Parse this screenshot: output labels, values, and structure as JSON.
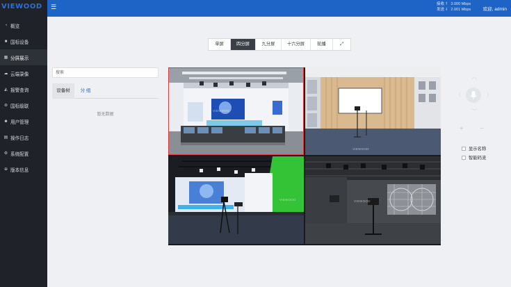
{
  "app": {
    "logo_text": "VIEWOOD"
  },
  "header": {
    "menu_icon": "menu-icon",
    "net": {
      "rx_label": "接收",
      "rx_value": "3.000 Mbps",
      "tx_label": "发送",
      "tx_value": "2.001 Mbps"
    },
    "welcome": "欢迎, admin"
  },
  "sidebar": {
    "items": [
      {
        "label": "概览",
        "icon": "gauge-icon",
        "glyph": "◔"
      },
      {
        "label": "国标设备",
        "icon": "camera-icon",
        "glyph": "■"
      },
      {
        "label": "分屏展示",
        "icon": "grid-icon",
        "glyph": "▦"
      },
      {
        "label": "云端录像",
        "icon": "cloud-icon",
        "glyph": "☁"
      },
      {
        "label": "报警查询",
        "icon": "bell-icon",
        "glyph": "◭"
      },
      {
        "label": "国标级联",
        "icon": "link-icon",
        "glyph": "⊛"
      },
      {
        "label": "用户管理",
        "icon": "user-icon",
        "glyph": "☻"
      },
      {
        "label": "操作日志",
        "icon": "file-icon",
        "glyph": "▤"
      },
      {
        "label": "系统配置",
        "icon": "gear-icon",
        "glyph": "⚙"
      },
      {
        "label": "版本信息",
        "icon": "info-icon",
        "glyph": "⊕"
      }
    ],
    "active_index": 2
  },
  "left_panel": {
    "search_placeholder": "搜索",
    "tabs": [
      "设备树",
      "分 组"
    ],
    "active_tab": 0,
    "empty_text": "暂无数据"
  },
  "split_toolbar": {
    "buttons": [
      "单屏",
      "四分屏",
      "九分屏",
      "十六分屏",
      "轮播"
    ],
    "active_index": 1,
    "fullscreen_icon": "fullscreen-icon"
  },
  "video_grid": {
    "watermark": "VIEWOOD",
    "selected_index": 0
  },
  "ptz": {
    "arrows": [
      "arrow-up-icon",
      "arrow-left-icon",
      "arrow-right-icon",
      "arrow-down-icon"
    ],
    "center_icon": "microphone-icon",
    "zoom_in": "+",
    "zoom_out": "−"
  },
  "options": {
    "show_name": "显示名称",
    "smart_stream": "智能码流"
  },
  "colors": {
    "header_blue": "#1e63c6",
    "sidebar_dark": "#1f2329",
    "toolbar_active": "#3a3f47",
    "selected_border": "#e03a3a",
    "green_screen": "#34c236"
  }
}
